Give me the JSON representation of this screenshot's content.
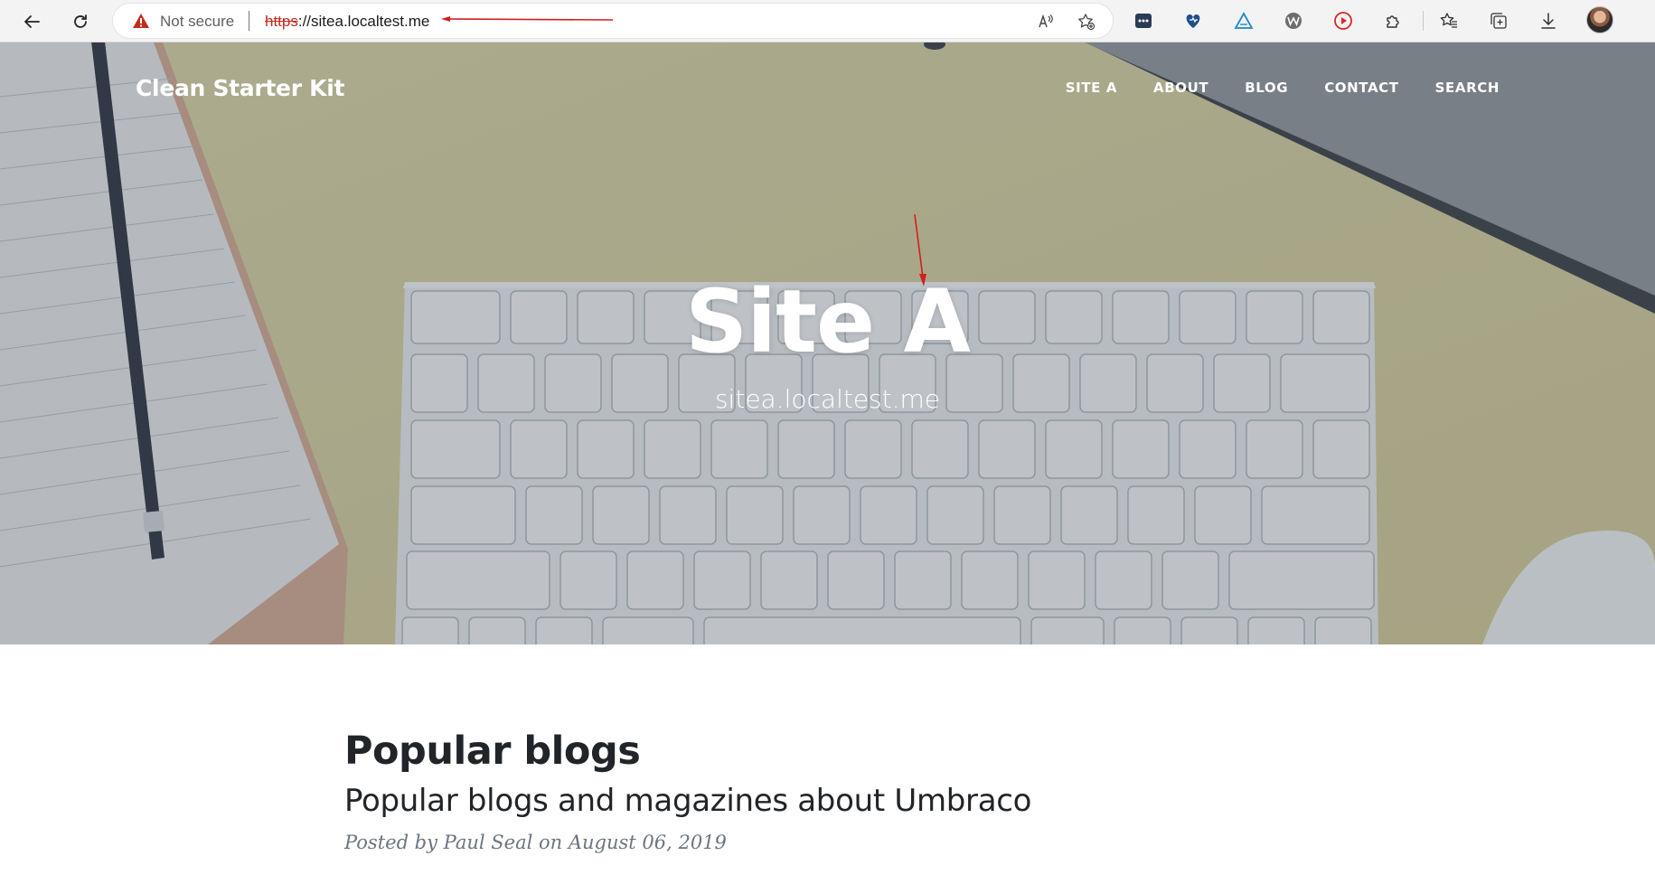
{
  "browser": {
    "security_label": "Not secure",
    "url_scheme": "https",
    "url_rest": "://sitea.localtest.me",
    "icons": {
      "back": "back-arrow-icon",
      "refresh": "refresh-icon",
      "warning": "warning-icon",
      "read_aloud": "read-aloud-icon",
      "add_favorite": "add-favorite-icon",
      "extensions": [
        "dots-extension-icon",
        "heart-extension-icon",
        "triangle-extension-icon",
        "w-extension-icon",
        "play-extension-icon",
        "puzzle-extensions-icon"
      ],
      "favorites": "favorites-icon",
      "collections": "collections-icon",
      "downloads": "download-icon",
      "profile": "profile-avatar"
    },
    "colors": {
      "warning": "#c42b1c",
      "annotation": "#d11f1f"
    }
  },
  "site": {
    "brand": "Clean Starter Kit",
    "nav": [
      "SITE A",
      "ABOUT",
      "BLOG",
      "CONTACT",
      "SEARCH"
    ]
  },
  "hero": {
    "title": "Site A",
    "subtitle": "sitea.localtest.me"
  },
  "post": {
    "title": "Popular blogs",
    "subtitle": "Popular blogs and magazines about Umbraco",
    "meta": "Posted by Paul Seal on August 06, 2019"
  }
}
